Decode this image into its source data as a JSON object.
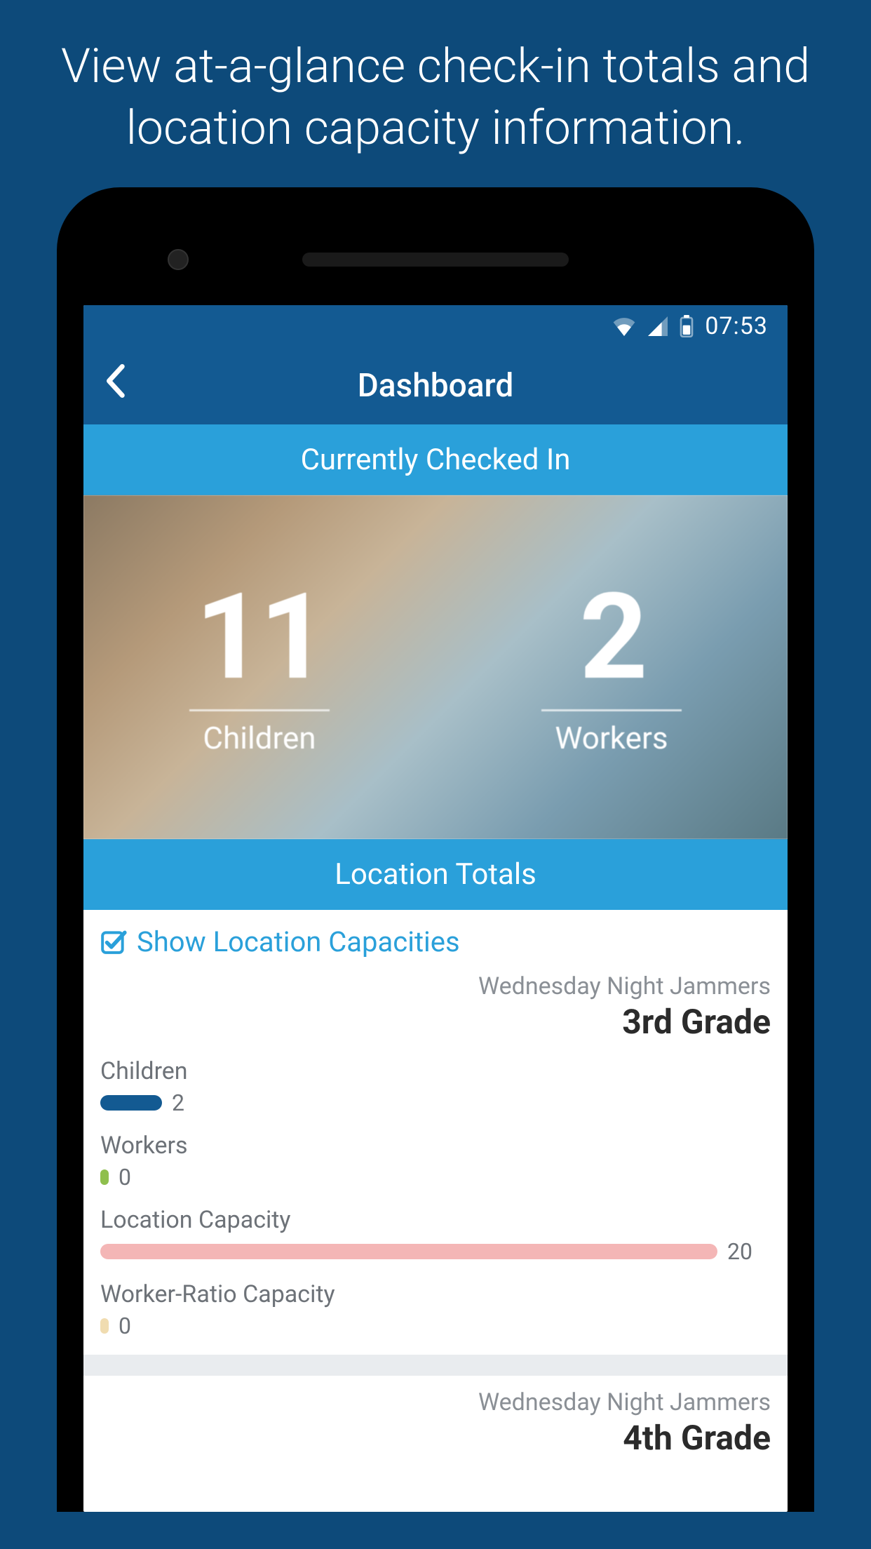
{
  "promo": "View at-a-glance check-in totals and location capacity information.",
  "statusbar": {
    "time": "07:53"
  },
  "appbar": {
    "title": "Dashboard"
  },
  "sections": {
    "checkedInHeader": "Currently Checked In",
    "locationTotalsHeader": "Location Totals",
    "showCapacitiesLabel": "Show Location Capacities"
  },
  "hero": {
    "children": {
      "count": "11",
      "label": "Children"
    },
    "workers": {
      "count": "2",
      "label": "Workers"
    }
  },
  "capacityBarMax": 20,
  "locations": [
    {
      "event": "Wednesday Night Jammers",
      "name": "3rd Grade",
      "metrics": {
        "children": {
          "label": "Children",
          "value": 2,
          "color": "blue"
        },
        "workers": {
          "label": "Workers",
          "value": 0,
          "color": "green"
        },
        "capacity": {
          "label": "Location Capacity",
          "value": 20,
          "color": "pink"
        },
        "workerRatio": {
          "label": "Worker-Ratio Capacity",
          "value": 0,
          "color": "cream"
        }
      }
    },
    {
      "event": "Wednesday Night Jammers",
      "name": "4th Grade"
    }
  ]
}
